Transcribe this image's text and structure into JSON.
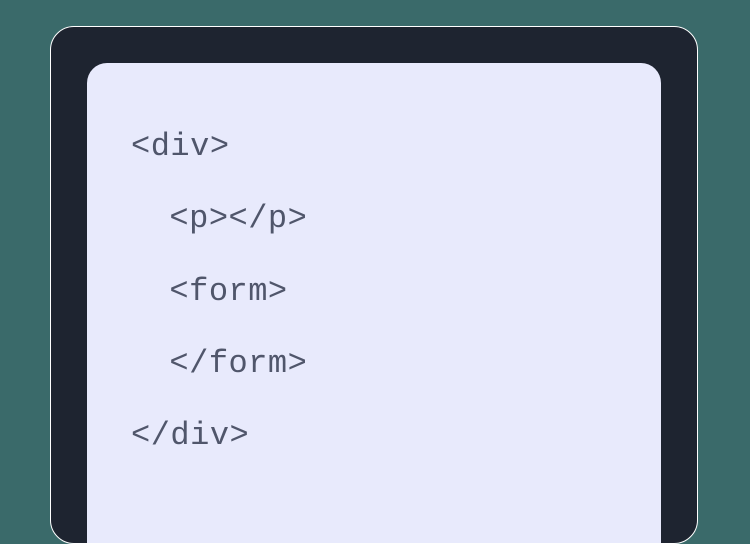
{
  "code": {
    "lines": [
      {
        "indent": 0,
        "text": "<div>"
      },
      {
        "indent": 1,
        "text": "<p></p>"
      },
      {
        "indent": 1,
        "text": "<form>"
      },
      {
        "indent": 1,
        "text": "</form>"
      },
      {
        "indent": 0,
        "text": "</div>"
      }
    ]
  }
}
